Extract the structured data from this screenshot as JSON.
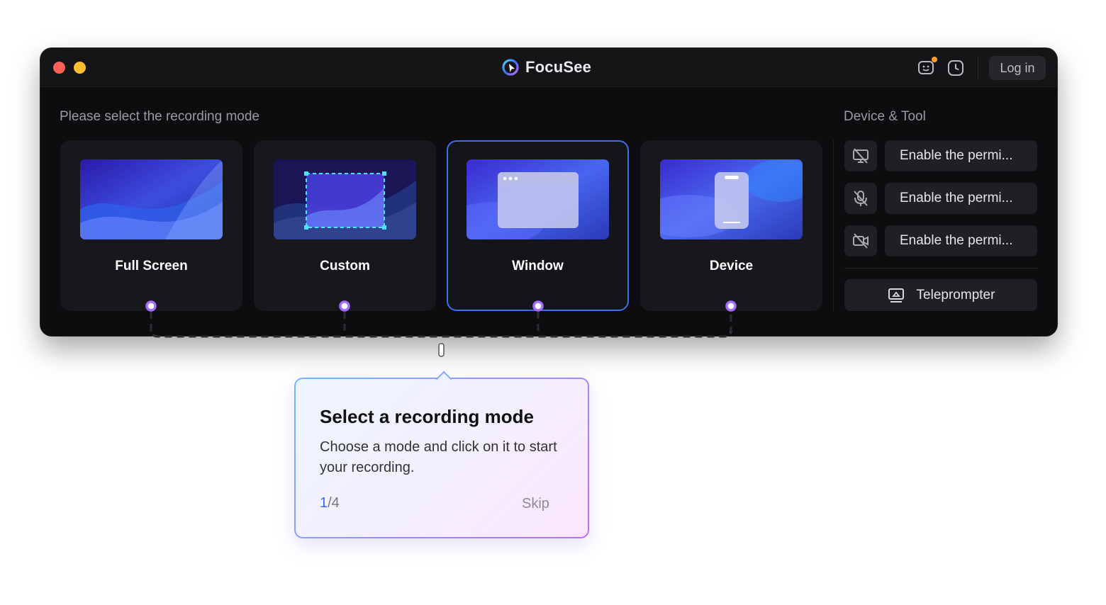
{
  "app": {
    "name": "FocuSee",
    "login_label": "Log in"
  },
  "main": {
    "section_label": "Please select the recording mode",
    "modes": [
      {
        "label": "Full Screen",
        "selected": false
      },
      {
        "label": "Custom",
        "selected": false
      },
      {
        "label": "Window",
        "selected": true
      },
      {
        "label": "Device",
        "selected": false
      }
    ]
  },
  "tools": {
    "section_label": "Device & Tool",
    "items": [
      {
        "icon": "screen-off-icon",
        "label": "Enable the permi..."
      },
      {
        "icon": "microphone-off-icon",
        "label": "Enable the permi..."
      },
      {
        "icon": "camera-off-icon",
        "label": "Enable the permi..."
      }
    ],
    "teleprompter_label": "Teleprompter"
  },
  "tooltip": {
    "title": "Select a recording mode",
    "body": "Choose a mode and click on it to start your recording.",
    "step_current": "1",
    "step_total": "/4",
    "skip_label": "Skip"
  },
  "colors": {
    "accent": "#3c6cf0",
    "connector": "#a66cff",
    "window_bg": "#0d0d0f",
    "card_bg": "#18181c"
  }
}
